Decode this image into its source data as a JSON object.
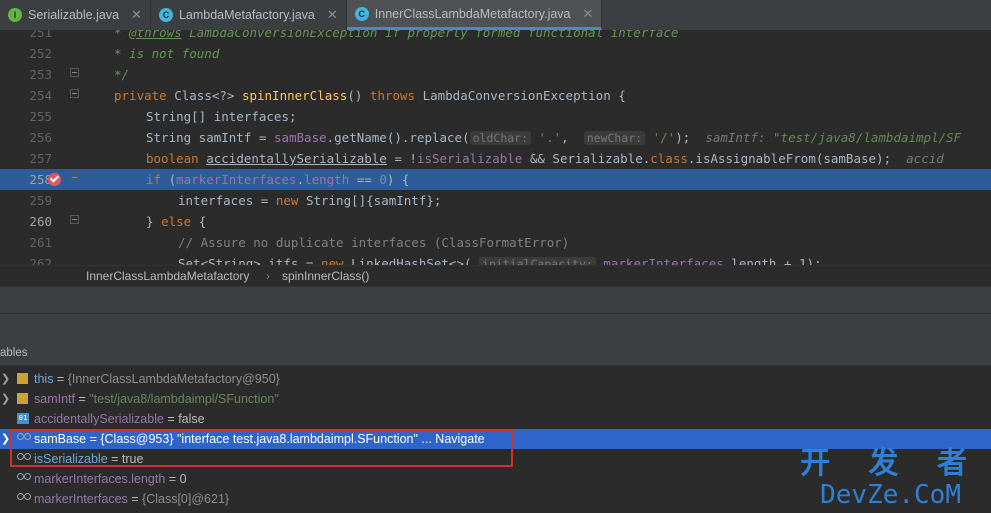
{
  "tabs": [
    {
      "label": "Serializable.java",
      "icon": "interface-icon",
      "active": false
    },
    {
      "label": "LambdaMetafactory.java",
      "icon": "class-icon",
      "active": false
    },
    {
      "label": "InnerClassLambdaMetafactory.java",
      "icon": "class-icon",
      "active": true
    }
  ],
  "editor": {
    "line_numbers": [
      "251",
      "252",
      "253",
      "254",
      "255",
      "256",
      "257",
      "258",
      "259",
      "260",
      "261",
      "262"
    ],
    "lines": {
      "l251_a": "* ",
      "l251_b": "@throws",
      "l251_c": " LambdaConversionException if properly formed functional interface",
      "l252": "* is not found",
      "l253": "*/",
      "l254_kw1": "private",
      "l254_a": " Class<?> ",
      "l254_b": "spinInnerClass",
      "l254_c": "() ",
      "l254_kw2": "throws",
      "l254_d": " LambdaConversionException {",
      "l255_a": "String[] interfaces;",
      "l256_a": "String samIntf = ",
      "l256_fld": "samBase",
      "l256_b": ".getName().replace(",
      "l256_h1": "oldChar:",
      "l256_s1": " '.'",
      "l256_c": ",  ",
      "l256_h2": "newChar:",
      "l256_s2": " '/'",
      "l256_d": ");  ",
      "l256_inl": "samIntf: ",
      "l256_inlv": "\"test/java8/lambdaimpl/SF",
      "l257_kw": "boolean",
      "l257_a": " ",
      "l257_var": "accidentallySerializable",
      "l257_b": " = !",
      "l257_fld": "isSerializable",
      "l257_c": " && Serializable.",
      "l257_kw2": "class",
      "l257_d": ".isAssignableFrom(",
      "l257_fld2": "samBase",
      "l257_e": ");  ",
      "l257_inl": "accid",
      "l258_kw": "if",
      "l258_a": " (",
      "l258_fld": "markerInterfaces",
      "l258_b": ".",
      "l258_fld2": "length",
      "l258_c": " == ",
      "l258_num": "0",
      "l258_d": ") {",
      "l259_a": "interfaces = ",
      "l259_kw": "new",
      "l259_b": " String[]{samIntf};",
      "l260_a": "} ",
      "l260_kw": "else",
      "l260_b": " {",
      "l261_cm": "// Assure no duplicate interfaces (ClassFormatError)",
      "l262_a": "Set<String> itfs = ",
      "l262_kw": "new",
      "l262_b": " LinkedHashSet<>( ",
      "l262_h": "initialCapacity:",
      "l262_fld": " markerInterfaces",
      "l262_c": ".length + 1);"
    }
  },
  "breadcrumb": {
    "items": [
      "InnerClassLambdaMetafactory",
      "spinInnerClass()"
    ],
    "separator": "›"
  },
  "variables_panel": {
    "title": "ables",
    "rows": [
      {
        "name": "this",
        "eq": " = ",
        "value": "{InnerClassLambdaMetafactory@950}",
        "icon": "field-icon",
        "expandable": true,
        "selected": false
      },
      {
        "name": "samIntf",
        "eq": " = ",
        "value": "\"test/java8/lambdaimpl/SFunction\"",
        "icon": "field-icon",
        "expandable": true,
        "selected": false
      },
      {
        "name": "accidentallySerializable",
        "eq": " = ",
        "value": "false",
        "icon": "boolean-icon",
        "expandable": false,
        "selected": false
      },
      {
        "name": "samBase",
        "eq": " = ",
        "value": "{Class@953} \"interface test.java8.lambdaimpl.SFunction\"",
        "extra": " ... Navigate",
        "icon": "watch-icon",
        "expandable": true,
        "selected": true
      },
      {
        "name": "isSerializable",
        "eq": " = ",
        "value": "true",
        "icon": "watch-icon",
        "expandable": false,
        "selected": false
      },
      {
        "name": "markerInterfaces.length",
        "eq": " = ",
        "value": "0",
        "icon": "watch-icon",
        "expandable": false,
        "selected": false
      },
      {
        "name": "markerInterfaces",
        "eq": " = ",
        "value": "{Class[0]@621}",
        "icon": "watch-icon",
        "expandable": false,
        "selected": false
      }
    ]
  },
  "watermark": {
    "line1": "开 发 者",
    "line2": "DevZe.CoM"
  },
  "colors": {
    "selection": "#2f65ca",
    "highlight_line": "#2d5c99",
    "annotation_box": "#d0312d",
    "watermark": "#2f7fd4"
  }
}
